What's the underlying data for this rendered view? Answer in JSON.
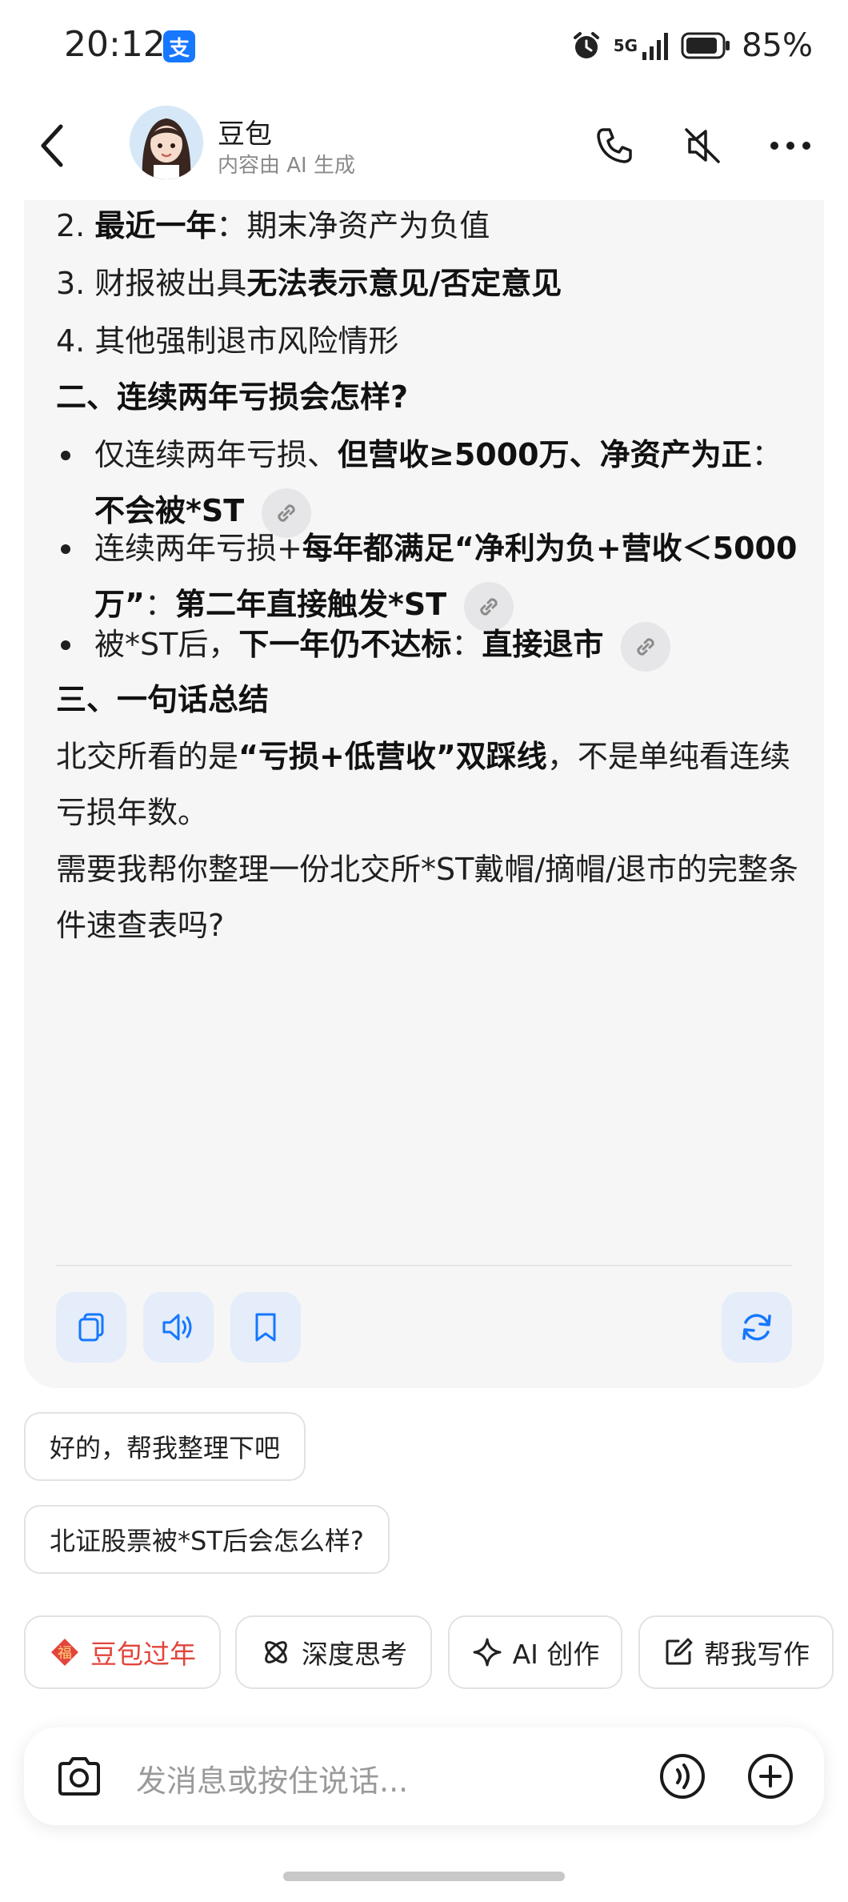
{
  "status_bar": {
    "time": "20:12",
    "app_badge": "支",
    "network": "5G",
    "battery": "85%"
  },
  "header": {
    "name": "豆包",
    "subtitle": "内容由 AI 生成"
  },
  "message": {
    "item2": {
      "num": "2. ",
      "bold": "最近一年",
      "rest": "：期末净资产为负值"
    },
    "item3": {
      "pre": "3. 财报被出具",
      "bold": "无法表示意见/否定意见"
    },
    "item4": {
      "text": "4. 其他强制退市风险情形"
    },
    "heading2": "二、连续两年亏损会怎样?",
    "bullet1": {
      "pre": "仅连续两年亏损、",
      "bold1": "但营收≥5000万、净资产为正",
      "mid": "：",
      "bold2": "不会被*ST"
    },
    "bullet2": {
      "pre": "连续两年亏损+",
      "bold1": "每年都满足“净利为负+营收＜5000万”",
      "mid": "：",
      "bold2": "第二年直接触发*ST"
    },
    "bullet3": {
      "pre": "被*ST后，",
      "bold1": "下一年仍不达标",
      "mid": "：",
      "bold2": "直接退市"
    },
    "heading3": "三、一句话总结",
    "summary": {
      "pre": "北交所看的是",
      "bold": "“亏损+低营收”双踩线",
      "rest": "，不是单纯看连续亏损年数。"
    },
    "question": "需要我帮你整理一份北交所*ST戴帽/摘帽/退市的完整条件速查表吗?"
  },
  "suggestions": [
    "好的，帮我整理下吧",
    "北证股票被*ST后会怎么样?"
  ],
  "tools": [
    {
      "label": "豆包过年",
      "icon": "fu-icon"
    },
    {
      "label": "深度思考",
      "icon": "atom-icon"
    },
    {
      "label": "AI 创作",
      "icon": "sparkle-icon"
    },
    {
      "label": "帮我写作",
      "icon": "edit-icon"
    }
  ],
  "input": {
    "placeholder": "发消息或按住说话..."
  },
  "colors": {
    "accent": "#1677ff",
    "red": "#e2453c",
    "card_bg": "#f6f6f7",
    "action_bg": "#e4edf9"
  }
}
